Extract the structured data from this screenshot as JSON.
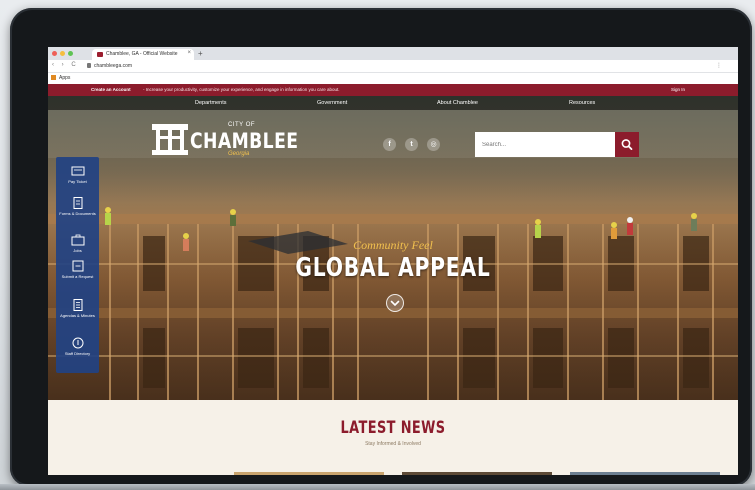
{
  "browser": {
    "tab_title": "Chamblee, GA - Official Website",
    "tab_close": "×",
    "new_tab": "+",
    "url": "chambleega.com",
    "nav": "‹ › C",
    "extension": "⋮",
    "bookmarks_label": "Apps"
  },
  "announcement": {
    "create_account": "Create an Account",
    "message": "- Increase your productivity, customize your experience, and engage in information you care about.",
    "sign_in": "Sign In"
  },
  "main_nav": {
    "items": [
      "Departments",
      "Government",
      "About Chamblee",
      "Resources"
    ]
  },
  "logo": {
    "city_of": "CITY OF",
    "name": "CHAMBLEE",
    "state": "Georgia"
  },
  "socials": {
    "icons": [
      "facebook-icon",
      "twitter-icon",
      "instagram-icon"
    ],
    "glyphs": [
      "f",
      "t",
      "◎"
    ]
  },
  "search": {
    "placeholder": "Search..."
  },
  "quick_links": {
    "items": [
      "Pay Ticket",
      "Forms & Documents",
      "Jobs",
      "Submit a Request",
      "Agendas & Minutes",
      "Staff Directory"
    ]
  },
  "hero": {
    "tagline": "Community Feel",
    "headline": "GLOBAL APPEAL"
  },
  "news": {
    "title": "LATEST NEWS",
    "subtitle": "Stay Informed & Involved"
  },
  "colors": {
    "brand_red": "#8c1c2c",
    "rail_blue": "#224283",
    "accent_gold": "#f2c14e"
  }
}
